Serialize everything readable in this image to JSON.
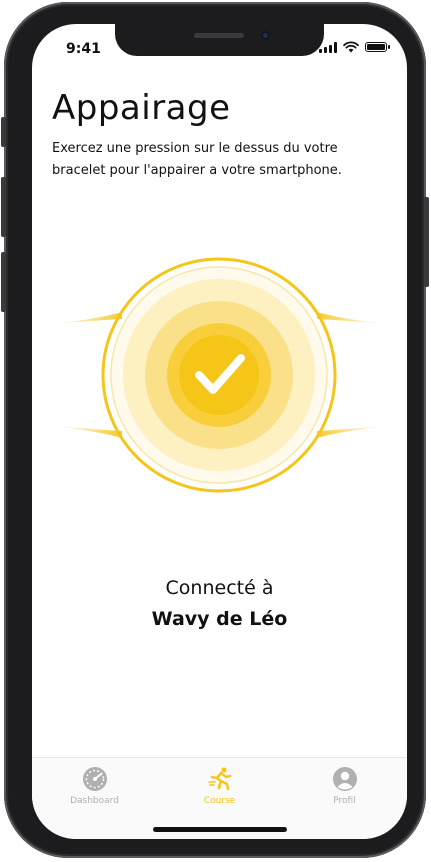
{
  "status_bar": {
    "time": "9:41"
  },
  "screen": {
    "title": "Appairage",
    "instruction": "Exercez une pression sur le dessus du votre bracelet pour l'appairer a votre smartphone.",
    "connection": {
      "label": "Connecté à",
      "device": "Wavy de Léo"
    }
  },
  "tabbar": {
    "tabs": [
      {
        "label": "Dashboard",
        "icon": "speedometer-icon",
        "active": false
      },
      {
        "label": "Course",
        "icon": "running-icon",
        "active": true
      },
      {
        "label": "Profil",
        "icon": "user-icon",
        "active": false
      }
    ]
  },
  "colors": {
    "accent": "#f5c518",
    "inactive": "#b0b0b0",
    "text": "#111111"
  }
}
